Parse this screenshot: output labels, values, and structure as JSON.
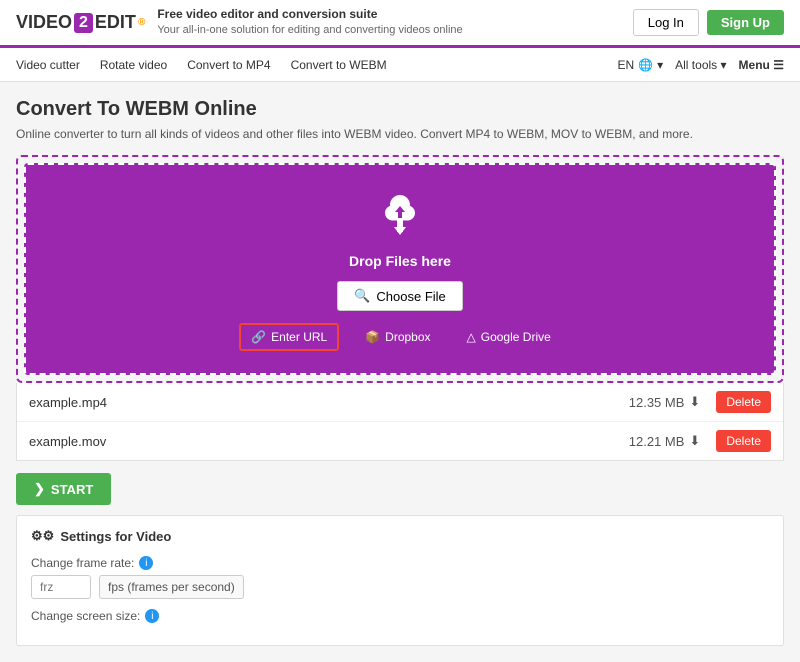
{
  "header": {
    "logo_video": "VIDEO",
    "logo_2": "2",
    "logo_edit": "EDIT",
    "logo_dot": "®",
    "tagline_title": "Free video editor and conversion suite",
    "tagline_sub": "Your all-in-one solution for editing and converting videos online",
    "btn_login": "Log In",
    "btn_signup": "Sign Up"
  },
  "nav": {
    "links": [
      {
        "label": "Video cutter"
      },
      {
        "label": "Rotate video"
      },
      {
        "label": "Convert to MP4"
      },
      {
        "label": "Convert to WEBM"
      }
    ],
    "lang": "EN",
    "all_tools": "All tools",
    "menu": "Menu"
  },
  "page": {
    "title": "Convert To WEBM Online",
    "description": "Online converter to turn all kinds of videos and other files into WEBM video. Convert MP4 to WEBM, MOV to WEBM, and more."
  },
  "upload": {
    "drop_text": "Drop Files here",
    "choose_file": "Choose File",
    "enter_url": "Enter URL",
    "dropbox": "Dropbox",
    "google_drive": "Google Drive"
  },
  "files": [
    {
      "name": "example.mp4",
      "size": "12.35 MB"
    },
    {
      "name": "example.mov",
      "size": "12.21 MB"
    }
  ],
  "file_delete_label": "Delete",
  "start_btn": "START",
  "settings": {
    "title": "Settings for Video",
    "frame_rate_label": "Change frame rate:",
    "frame_rate_placeholder": "frz",
    "frame_rate_desc": "fps (frames per second)",
    "screen_size_label": "Change screen size:"
  },
  "icons": {
    "cloud": "☁",
    "search": "🔍",
    "link": "🔗",
    "dropbox": "📦",
    "drive": "△",
    "gear": "⚙",
    "arrow_right": "❯",
    "download": "⬇"
  }
}
